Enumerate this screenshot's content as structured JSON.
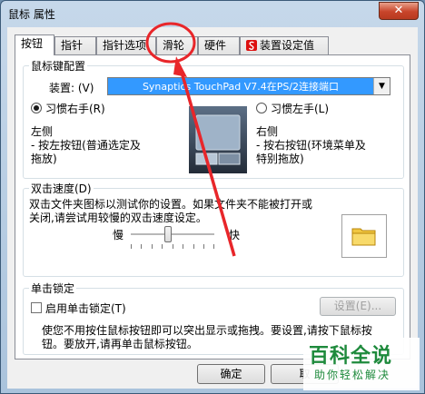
{
  "window": {
    "title": "鼠标 属性",
    "close_glyph": "✕"
  },
  "tabs": [
    {
      "label": "按钮",
      "active": true
    },
    {
      "label": "指针",
      "active": false
    },
    {
      "label": "指针选项",
      "active": false
    },
    {
      "label": "滑轮",
      "active": false
    },
    {
      "label": "硬件",
      "active": false
    },
    {
      "label": "装置设定值",
      "active": false,
      "icon": "synaptics-icon"
    }
  ],
  "button_config": {
    "group_title": "鼠标键配置",
    "device_label": "装置: (V)",
    "device_value": "Synaptics TouchPad V7.4在PS/2连接端口",
    "right_hand_label": "习惯右手(R)",
    "right_hand_selected": true,
    "left_hand_label": "习惯左手(L)",
    "left_hand_selected": false,
    "left_side_title": "左侧",
    "left_side_desc_1": "- 按左按钮(普通选定及",
    "left_side_desc_2": "拖放)",
    "right_side_title": "右侧",
    "right_side_desc_1": "- 按右按钮(环境菜单及",
    "right_side_desc_2": "特别拖放)"
  },
  "double_click": {
    "group_title": "双击速度(D)",
    "desc_1": "双击文件夹图标以测试你的设置。如果文件夹不能被打开或",
    "desc_2": "关闭,请尝试用较慢的双击速度设定。",
    "slow_label": "慢",
    "fast_label": "快",
    "speed_level": 0.45
  },
  "click_lock": {
    "group_title": "单击锁定",
    "enable_label": "启用单击锁定(T)",
    "enabled": false,
    "settings_label": "设置(E)...",
    "desc_1": "使您不用按住鼠标按钮即可以突出显示或拖拽。要设置,请按下鼠标按",
    "desc_2": "钮。要放开,请再单击鼠标按钮。"
  },
  "footer": {
    "ok_label": "确定",
    "cancel_label": "取"
  },
  "watermark": {
    "main": "百科全说",
    "sub": "助你轻松解决"
  },
  "colors": {
    "annotation_red": "#e8262a",
    "selection_blue": "#3399ff",
    "watermark_green": "#1e8a3c"
  }
}
